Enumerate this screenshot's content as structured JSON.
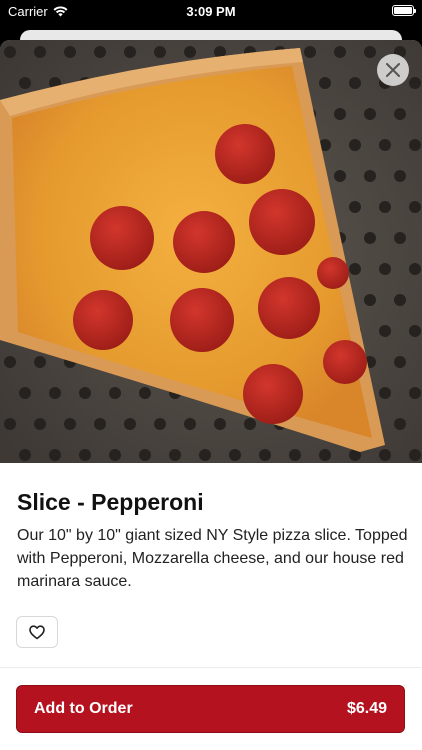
{
  "status_bar": {
    "carrier": "Carrier",
    "time": "3:09 PM",
    "wifi_icon": "wifi-icon",
    "battery_icon": "battery-icon",
    "battery_level": 1.0
  },
  "item": {
    "image_icon": "pepperoni-pizza-photo",
    "close_icon": "close-icon",
    "title": "Slice - Pepperoni",
    "description": "Our 10\" by 10\" giant sized NY Style pizza slice. Topped with Pepperoni, Mozzarella cheese, and our house red marinara sauce.",
    "favorite_icon": "heart-icon"
  },
  "order": {
    "add_label": "Add to Order",
    "price": "$6.49",
    "button_color": "#b5121f"
  }
}
